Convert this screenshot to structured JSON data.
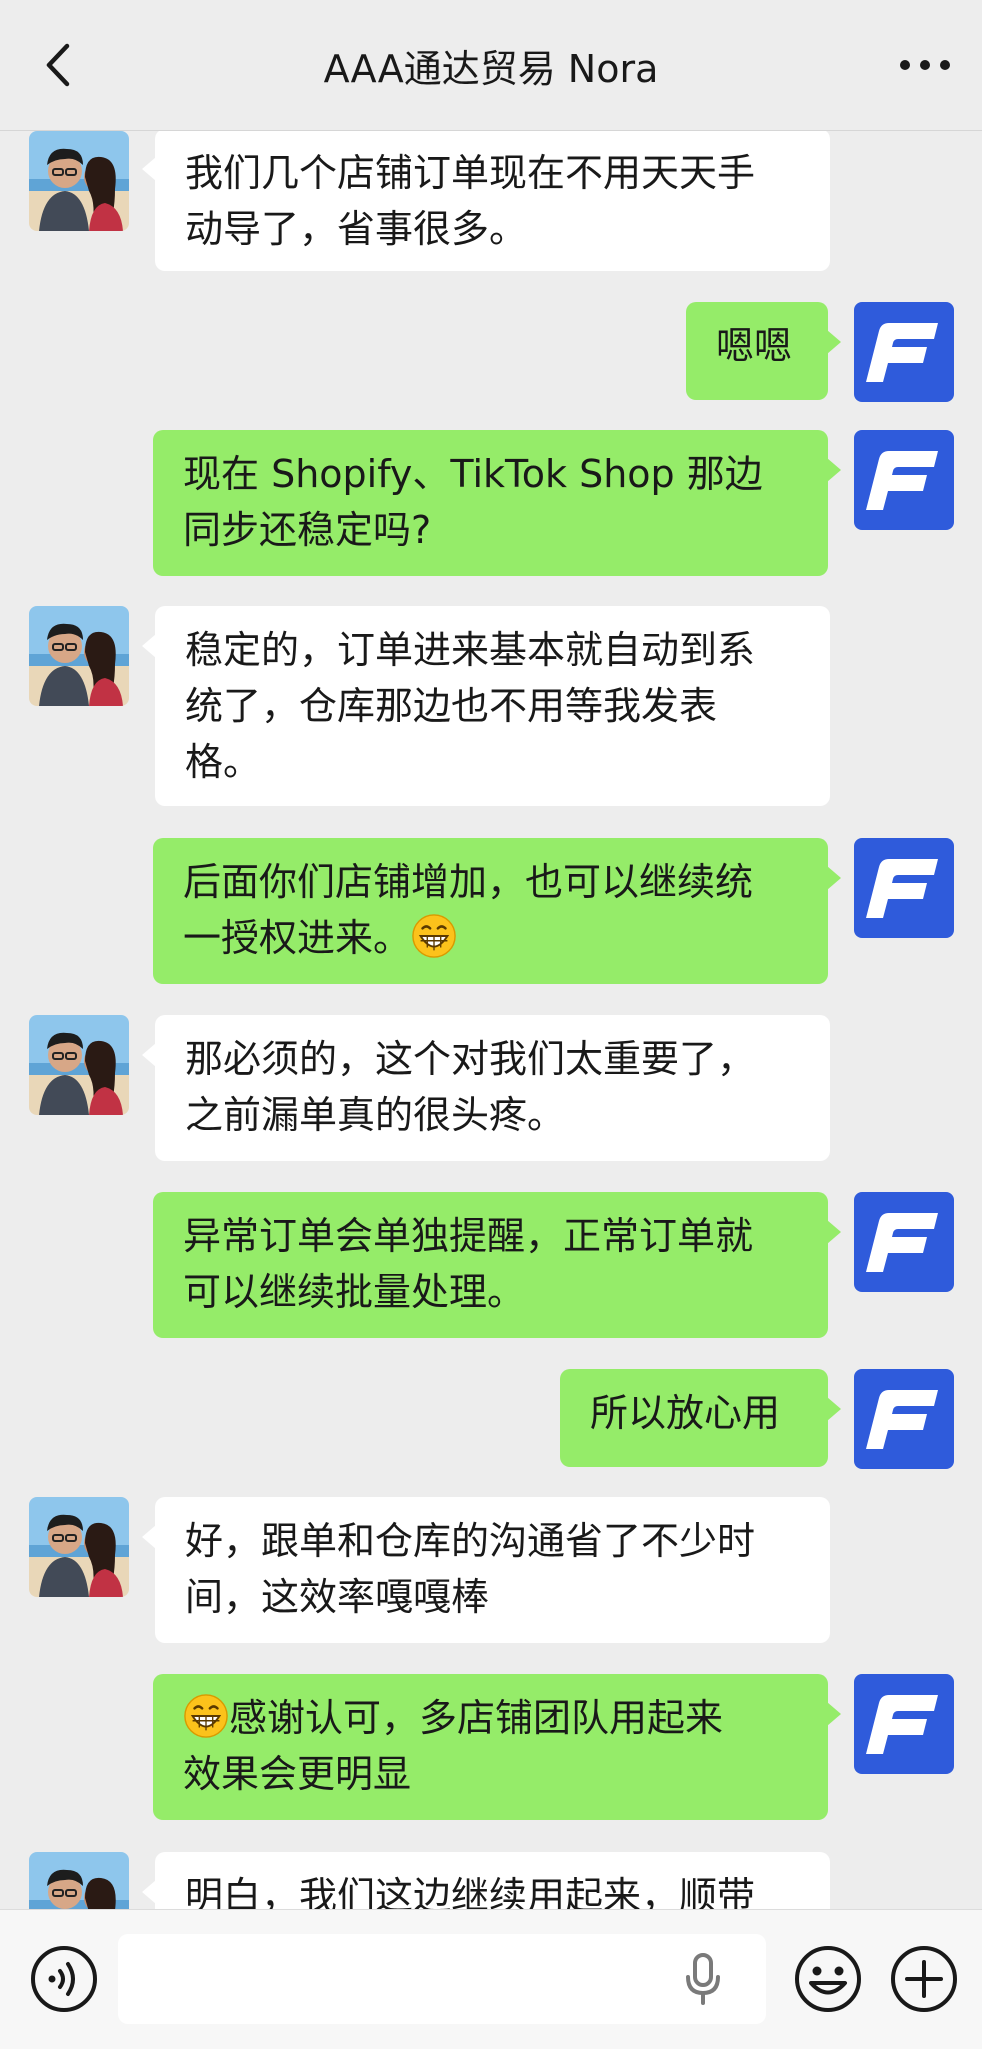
{
  "header": {
    "title": "AAA通达贸易 Nora"
  },
  "messages": [
    {
      "side": "in",
      "lines": [
        "我们几个店铺订单现在不用天天手",
        "动导了，省事很多。"
      ]
    },
    {
      "side": "out",
      "lines": [
        "嗯嗯"
      ]
    },
    {
      "side": "out",
      "lines": [
        "现在 Shopify、TikTok Shop 那边",
        "同步还稳定吗?"
      ]
    },
    {
      "side": "in",
      "lines": [
        "稳定的，订单进来基本就自动到系",
        "统了，仓库那边也不用等我发表",
        "格。"
      ]
    },
    {
      "side": "out",
      "lines": [
        "后面你们店铺增加，也可以继续统",
        "一授权进来。"
      ],
      "emoji_end": "grinning-emoji"
    },
    {
      "side": "in",
      "lines": [
        "那必须的，这个对我们太重要了，",
        "之前漏单真的很头疼。"
      ]
    },
    {
      "side": "out",
      "lines": [
        "异常订单会单独提醒，正常订单就",
        "可以继续批量处理。"
      ]
    },
    {
      "side": "out",
      "lines": [
        "所以放心用"
      ]
    },
    {
      "side": "in",
      "lines": [
        "好，跟单和仓库的沟通省了不少时",
        "间，这效率嘎嘎棒"
      ]
    },
    {
      "side": "out",
      "lines": [
        "感谢认可，多店铺团队用起来",
        "效果会更明显"
      ],
      "emoji_start": "grinning-emoji"
    },
    {
      "side": "in",
      "lines": [
        "明白，我们这边继续用起来，顺带"
      ]
    }
  ],
  "icons": {
    "back": "chevron-left-icon",
    "more": "more-dots-icon",
    "voice": "voice-icon",
    "mic": "microphone-icon",
    "emoji": "emoji-icon",
    "plus": "plus-icon",
    "my_avatar": "brand-f-logo",
    "contact_avatar": "couple-beach-photo"
  },
  "colors": {
    "background": "#ededed",
    "incoming_bubble": "#ffffff",
    "outgoing_bubble": "#95ec69",
    "brand_blue": "#2f5bdb"
  }
}
